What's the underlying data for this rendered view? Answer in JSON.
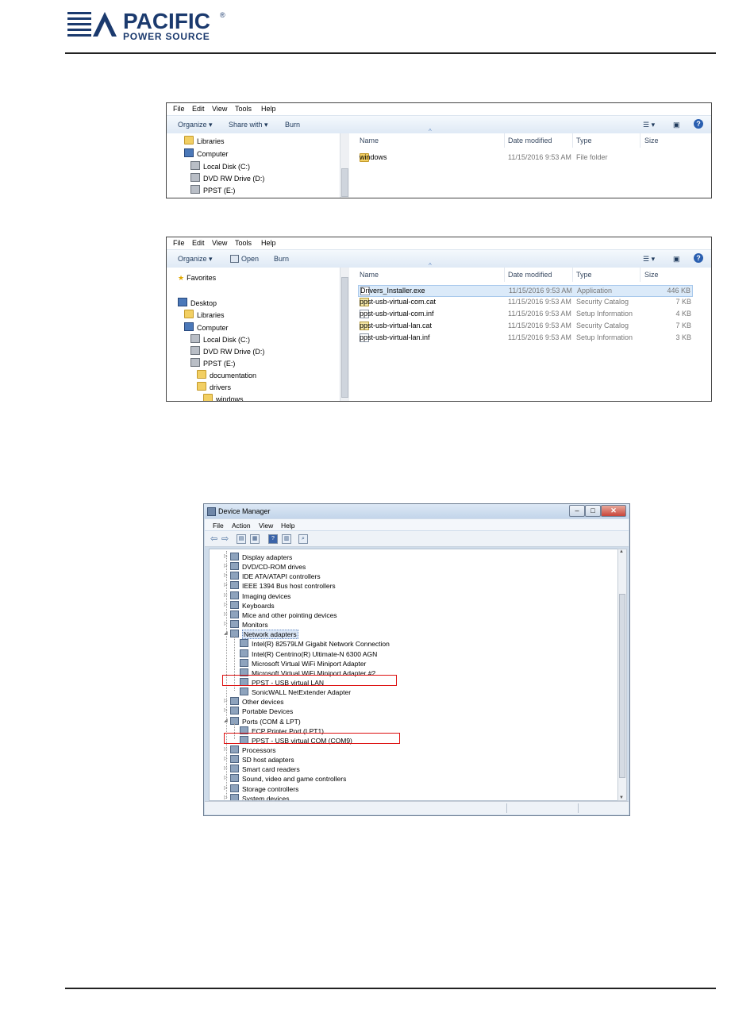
{
  "header": {
    "brand": "PACIFIC",
    "reg": "®",
    "sub": "POWER SOURCE"
  },
  "explorer1": {
    "menu": [
      "File",
      "Edit",
      "View",
      "Tools",
      "Help"
    ],
    "toolbar": {
      "organize": "Organize ▾",
      "share": "Share with ▾",
      "burn": "Burn"
    },
    "nav": [
      {
        "label": "Libraries",
        "icon": "folder-icon"
      },
      {
        "label": "Computer",
        "icon": "computer-icon"
      },
      {
        "label": "Local Disk (C:)",
        "icon": "drive-icon"
      },
      {
        "label": "DVD RW Drive (D:)",
        "icon": "drive-icon"
      },
      {
        "label": "PPST (E:)",
        "icon": "drive-icon"
      }
    ],
    "columns": {
      "name": "Name",
      "date": "Date modified",
      "type": "Type",
      "size": "Size"
    },
    "rows": [
      {
        "name": "windows",
        "date": "11/15/2016 9:53 AM",
        "type": "File folder",
        "size": ""
      }
    ]
  },
  "explorer2": {
    "menu": [
      "File",
      "Edit",
      "View",
      "Tools",
      "Help"
    ],
    "toolbar": {
      "organize": "Organize ▾",
      "open": "Open",
      "burn": "Burn"
    },
    "nav": [
      {
        "label": "Favorites",
        "icon": "star-icon"
      },
      {
        "label": "Desktop",
        "icon": "desktop-icon"
      },
      {
        "label": "Libraries",
        "icon": "folder-icon"
      },
      {
        "label": "Computer",
        "icon": "computer-icon"
      },
      {
        "label": "Local Disk (C:)",
        "icon": "drive-icon"
      },
      {
        "label": "DVD RW Drive (D:)",
        "icon": "drive-icon"
      },
      {
        "label": "PPST (E:)",
        "icon": "drive-icon"
      },
      {
        "label": "documentation",
        "icon": "folder-icon"
      },
      {
        "label": "drivers",
        "icon": "folder-icon"
      },
      {
        "label": "windows",
        "icon": "folder-icon"
      }
    ],
    "columns": {
      "name": "Name",
      "date": "Date modified",
      "type": "Type",
      "size": "Size"
    },
    "rows": [
      {
        "name": "Drivers_Installer.exe",
        "date": "11/15/2016 9:53 AM",
        "type": "Application",
        "size": "446 KB"
      },
      {
        "name": "ppst-usb-virtual-com.cat",
        "date": "11/15/2016 9:53 AM",
        "type": "Security Catalog",
        "size": "7 KB"
      },
      {
        "name": "ppst-usb-virtual-com.inf",
        "date": "11/15/2016 9:53 AM",
        "type": "Setup Information",
        "size": "4 KB"
      },
      {
        "name": "ppst-usb-virtual-lan.cat",
        "date": "11/15/2016 9:53 AM",
        "type": "Security Catalog",
        "size": "7 KB"
      },
      {
        "name": "ppst-usb-virtual-lan.inf",
        "date": "11/15/2016 9:53 AM",
        "type": "Setup Information",
        "size": "3 KB"
      }
    ]
  },
  "devmgr": {
    "title": "Device Manager",
    "menu": [
      "File",
      "Action",
      "View",
      "Help"
    ],
    "tree": [
      {
        "label": "Display adapters",
        "level": 1,
        "arrow": "▷"
      },
      {
        "label": "DVD/CD-ROM drives",
        "level": 1,
        "arrow": "▷"
      },
      {
        "label": "IDE ATA/ATAPI controllers",
        "level": 1,
        "arrow": "▷"
      },
      {
        "label": "IEEE 1394 Bus host controllers",
        "level": 1,
        "arrow": "▷"
      },
      {
        "label": "Imaging devices",
        "level": 1,
        "arrow": "▷"
      },
      {
        "label": "Keyboards",
        "level": 1,
        "arrow": "▷"
      },
      {
        "label": "Mice and other pointing devices",
        "level": 1,
        "arrow": "▷"
      },
      {
        "label": "Monitors",
        "level": 1,
        "arrow": "▷"
      },
      {
        "label": "Network adapters",
        "level": 1,
        "arrow": "◢"
      },
      {
        "label": "Intel(R) 82579LM Gigabit Network Connection",
        "level": 2,
        "arrow": ""
      },
      {
        "label": "Intel(R) Centrino(R) Ultimate-N 6300 AGN",
        "level": 2,
        "arrow": ""
      },
      {
        "label": "Microsoft Virtual WiFi Miniport Adapter",
        "level": 2,
        "arrow": ""
      },
      {
        "label": "Microsoft Virtual WiFi Miniport Adapter #2",
        "level": 2,
        "arrow": ""
      },
      {
        "label": "PPST - USB virtual LAN",
        "level": 2,
        "arrow": ""
      },
      {
        "label": "SonicWALL NetExtender Adapter",
        "level": 2,
        "arrow": ""
      },
      {
        "label": "Other devices",
        "level": 1,
        "arrow": "▷"
      },
      {
        "label": "Portable Devices",
        "level": 1,
        "arrow": "▷"
      },
      {
        "label": "Ports (COM & LPT)",
        "level": 1,
        "arrow": "◢"
      },
      {
        "label": "ECP Printer Port (LPT1)",
        "level": 2,
        "arrow": ""
      },
      {
        "label": "PPST - USB virtual COM (COM9)",
        "level": 2,
        "arrow": ""
      },
      {
        "label": "Processors",
        "level": 1,
        "arrow": "▷"
      },
      {
        "label": "SD host adapters",
        "level": 1,
        "arrow": "▷"
      },
      {
        "label": "Smart card readers",
        "level": 1,
        "arrow": "▷"
      },
      {
        "label": "Sound, video and game controllers",
        "level": 1,
        "arrow": "▷"
      },
      {
        "label": "Storage controllers",
        "level": 1,
        "arrow": "▷"
      },
      {
        "label": "System devices",
        "level": 1,
        "arrow": "▷"
      }
    ]
  }
}
